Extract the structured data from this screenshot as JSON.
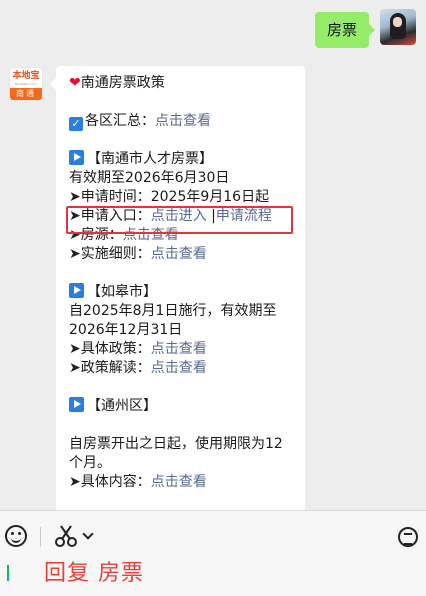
{
  "outgoing": {
    "text": "房票"
  },
  "incoming": {
    "lines": [
      {
        "type": "heading",
        "text": "南通房票政策"
      },
      {
        "type": "blank"
      },
      {
        "type": "check_link",
        "label": "各区汇总：",
        "link": "点击查看"
      },
      {
        "type": "blank"
      },
      {
        "type": "section",
        "text": "【南通市人才房票】"
      },
      {
        "type": "text",
        "text": "有效期至2026年6月30日"
      },
      {
        "type": "arrow_text",
        "text": "申请时间：2025年9月16日起"
      },
      {
        "type": "arrow_links",
        "label": "申请入口：",
        "links": [
          "点击进入",
          "申请流程"
        ]
      },
      {
        "type": "arrow_link",
        "label": "房源：",
        "link": "点击查看"
      },
      {
        "type": "arrow_link",
        "label": "实施细则：",
        "link": "点击查看"
      },
      {
        "type": "blank"
      },
      {
        "type": "section",
        "text": "【如皋市】"
      },
      {
        "type": "text",
        "text": "自2025年8月1日施行，有效期至"
      },
      {
        "type": "text",
        "text": "2026年12月31日"
      },
      {
        "type": "arrow_link",
        "label": "具体政策：",
        "link": "点击查看"
      },
      {
        "type": "arrow_link",
        "label": "政策解读：",
        "link": "点击查看"
      },
      {
        "type": "blank"
      },
      {
        "type": "section",
        "text": "【通州区】"
      },
      {
        "type": "blank"
      },
      {
        "type": "text",
        "text": "自房票开出之日起，使用期限为12"
      },
      {
        "type": "text",
        "text": "个月。"
      },
      {
        "type": "arrow_link",
        "label": "具体内容：",
        "link": "点击查看"
      }
    ]
  },
  "bot_avatar": {
    "logo": "本地宝",
    "tagline": "BenDiBao.com",
    "city": "南通"
  },
  "composer": {
    "reply_hint": "回复 房票"
  },
  "icons": {
    "heart": "heart-icon",
    "check": "checkbox-icon",
    "play": "play-icon",
    "emoji": "emoji-icon",
    "scissors": "scissors-icon",
    "voice": "voice-icon"
  },
  "colors": {
    "outgoing_bubble": "#95ec69",
    "link": "#576b95",
    "highlight_box": "#e5323c",
    "reply_hint": "#e8403a",
    "play_icon": "#2a7de1"
  }
}
